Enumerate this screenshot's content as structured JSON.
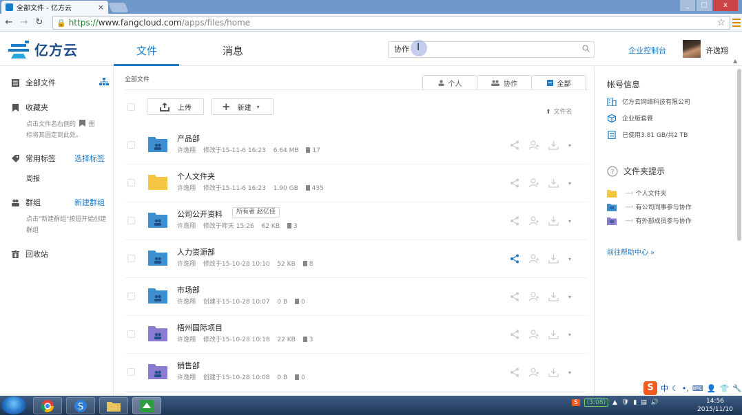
{
  "browser": {
    "tab_title": "全部文件 - 亿方云",
    "tab_close": "×",
    "url_scheme": "https://",
    "url_host": "www.fangcloud.com",
    "url_path": "/apps/files/home",
    "window_controls": [
      "_",
      "□",
      "x"
    ]
  },
  "header": {
    "brand": "亿方云",
    "tabs": [
      {
        "label": "文件",
        "active": true
      },
      {
        "label": "消息",
        "active": false
      }
    ],
    "search_value": "协作",
    "console_link": "企业控制台",
    "username": "许逸翔"
  },
  "sidebar": {
    "all_files": "全部文件",
    "favorites": "收藏夹",
    "favorites_hint_a": "点击文件名右侧的",
    "favorites_hint_b": "图",
    "favorites_hint_c": "标将其固定到此处。",
    "tags": "常用标签",
    "tags_link": "选择标签",
    "tag_item": "周报",
    "groups": "群组",
    "groups_link": "新建群组",
    "groups_hint": "点击\"新建群组\"按钮开始创建群组",
    "trash": "回收站"
  },
  "main": {
    "breadcrumb": "全部文件",
    "filter_tabs": [
      {
        "label": "个人",
        "icon": "user-icon"
      },
      {
        "label": "协作",
        "icon": "users-icon"
      },
      {
        "label": "全部",
        "icon": "square-icon",
        "active": true
      }
    ],
    "upload": "上传",
    "new": "新建",
    "new_caret": "▾",
    "sort_label": "文件名",
    "rows": [
      {
        "name": "产品部",
        "owner": "许逸翔",
        "time": "修改于15-11-6 16:23",
        "size": "6.64 MB",
        "count": "17",
        "color": "blue",
        "badge": ""
      },
      {
        "name": "个人文件夹",
        "owner": "许逸翔",
        "time": "修改于15-11-6 16:23",
        "size": "1.90 GB",
        "count": "435",
        "color": "yellow",
        "badge": ""
      },
      {
        "name": "公司公开资料",
        "owner": "许逸翔",
        "time": "修改于昨天 15:26",
        "size": "62 KB",
        "count": "3",
        "color": "blue",
        "badge": "所有者  赵亿佳"
      },
      {
        "name": "人力资源部",
        "owner": "许逸翔",
        "time": "修改于15-10-28 10:10",
        "size": "52 KB",
        "count": "8",
        "color": "blue",
        "badge": ""
      },
      {
        "name": "市场部",
        "owner": "许逸翔",
        "time": "创建于15-10-28 10:07",
        "size": "0 B",
        "count": "0",
        "color": "blue",
        "badge": ""
      },
      {
        "name": "梧州国际项目",
        "owner": "许逸翔",
        "time": "修改于15-10-28 10:18",
        "size": "22 KB",
        "count": "3",
        "color": "purple",
        "badge": ""
      },
      {
        "name": "销售部",
        "owner": "许逸翔",
        "time": "创建于15-10-28 10:08",
        "size": "0 B",
        "count": "0",
        "color": "purple",
        "badge": ""
      }
    ]
  },
  "right_panel": {
    "account_title": "帐号信息",
    "company": "亿方云网络科技有限公司",
    "plan": "企业版套餐",
    "usage": "已使用3.81 GB/共2 TB",
    "tips_title": "文件夹提示",
    "tips": [
      {
        "label": "个人文件夹",
        "color": "yellow"
      },
      {
        "label": "有公司同事参与协作",
        "color": "blue"
      },
      {
        "label": "有外部成员参与协作",
        "color": "purple"
      }
    ],
    "tip_arrow": "----›",
    "help_link": "前往帮助中心 »"
  },
  "ime": {
    "logo": "S",
    "mode": "中"
  },
  "taskbar": {
    "battery": "(3:08)",
    "time": "14:56",
    "date": "2015/11/10"
  },
  "colors": {
    "accent": "#1a7bc9",
    "folder_blue": "#3d8fd0",
    "folder_yellow": "#f5c542",
    "folder_purple": "#8c7ad0"
  }
}
